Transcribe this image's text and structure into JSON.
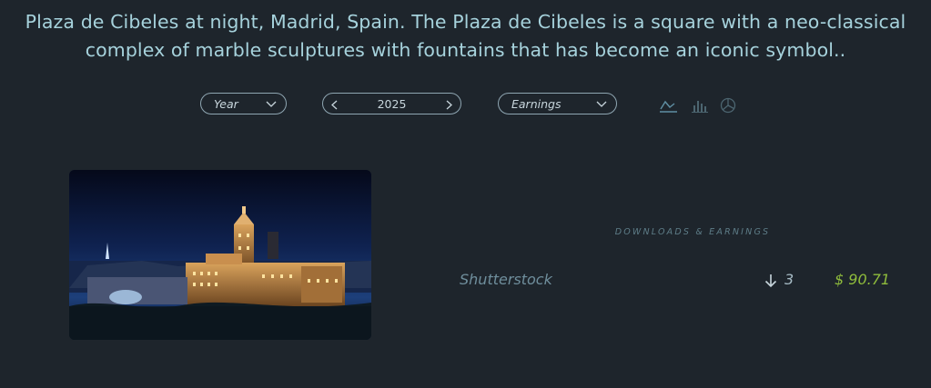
{
  "header": {
    "title": "Plaza de Cibeles at night, Madrid, Spain. The Plaza de Cibeles is a square with a neo-classical complex of marble sculptures with fountains that has become an iconic symbol.."
  },
  "filters": {
    "period": {
      "value": "Year",
      "icon": "chevron-down-icon"
    },
    "year": {
      "value": "2025",
      "prev_icon": "chevron-left-icon",
      "next_icon": "chevron-right-icon"
    },
    "metric": {
      "value": "Earnings",
      "icon": "chevron-down-icon"
    }
  },
  "chart_types": [
    {
      "name": "line-chart-icon",
      "selected": true
    },
    {
      "name": "bar-chart-icon",
      "selected": false
    },
    {
      "name": "pie-chart-icon",
      "selected": false
    }
  ],
  "photo": {
    "subject": "Plaza de Cibeles at night, Madrid"
  },
  "stats": {
    "section_label": "DOWNLOADS & EARNINGS",
    "rows": [
      {
        "platform": "Shutterstock",
        "downloads": "3",
        "earnings": "$ 90.71"
      }
    ]
  },
  "colors": {
    "background": "#1e252c",
    "title": "#a6d2dc",
    "accent_green": "#8fbc3c",
    "muted": "#5e7d88"
  }
}
